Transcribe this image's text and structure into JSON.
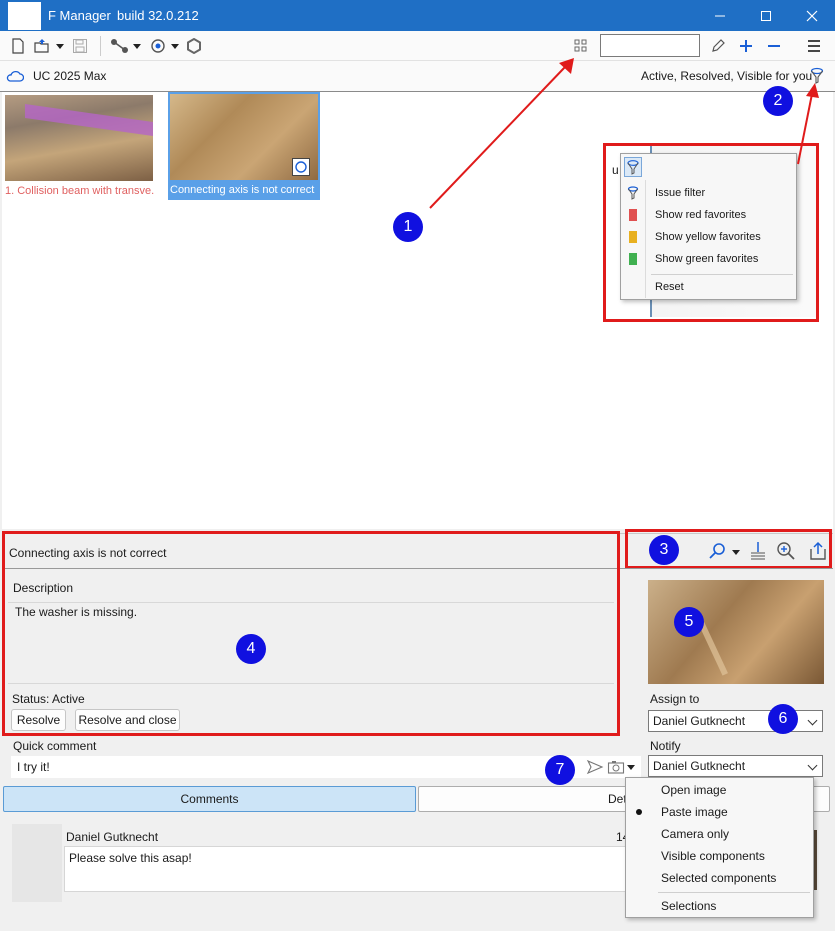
{
  "window": {
    "title": "F Manager",
    "build": "build 32.0.212"
  },
  "project": {
    "name": "UC 2025 Max",
    "filter_status": "Active, Resolved, Visible for you"
  },
  "issues": [
    {
      "caption": "1. Collision beam with transve...",
      "selected": false
    },
    {
      "caption": "Connecting axis is not correct",
      "selected": true
    }
  ],
  "filter_menu": {
    "prefix": "u",
    "items": [
      "Issue filter",
      "Show red favorites",
      "Show yellow favorites",
      "Show green favorites",
      "Reset"
    ]
  },
  "annotations": [
    "1",
    "2",
    "3",
    "4",
    "5",
    "6",
    "7"
  ],
  "detail": {
    "title": "Connecting axis is not correct",
    "description_label": "Description",
    "description": "The washer is missing.",
    "status": "Status: Active",
    "resolve_label": "Resolve",
    "resolve_close_label": "Resolve and close"
  },
  "assign": {
    "assign_label": "Assign to",
    "assign_value": "Daniel Gutknecht",
    "notify_label": "Notify",
    "notify_value": "Daniel Gutknecht"
  },
  "quick_comment": {
    "label": "Quick comment",
    "value": "I try it!"
  },
  "tabs": [
    "Comments",
    "Det"
  ],
  "comment": {
    "author": "Daniel Gutknecht",
    "time": "14",
    "text": "Please solve this asap!"
  },
  "attach_menu": {
    "items": [
      "Open image",
      "Paste image",
      "Camera only",
      "Visible components",
      "Selected components",
      "Selections"
    ],
    "checked_index": 1
  },
  "colors": {
    "titlebar": "#1f6fc5",
    "highlight": "#e01b1b",
    "badge": "#1010e0",
    "accent": "#1a5fd6",
    "red_fav": "#e05050",
    "yellow_fav": "#e8b020",
    "green_fav": "#40b050",
    "issue1_caption": "#e06060"
  }
}
